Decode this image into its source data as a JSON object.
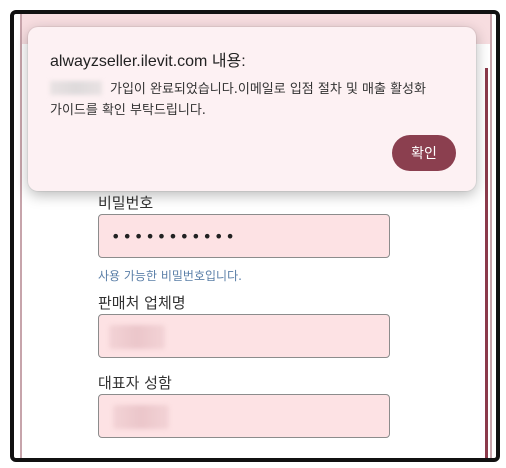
{
  "dialog": {
    "title": "alwayzseller.ilevit.com 내용:",
    "message_line1": "가입이 완료되었습니다.이메일로 입점 절차 및 매출 활성화",
    "message_line2": "가이드를 확인 부탁드립니다.",
    "ok_label": "확인"
  },
  "form": {
    "password_label": "비밀번호",
    "password_value": "•••••••••••",
    "password_hint": "사용 가능한 비밀번호입니다.",
    "company_label": "판매처 업체명",
    "ceo_label": "대표자 성함"
  },
  "colors": {
    "accent": "#8b3f4f",
    "field_bg": "#fde2e4",
    "hint": "#5b7fa8"
  }
}
